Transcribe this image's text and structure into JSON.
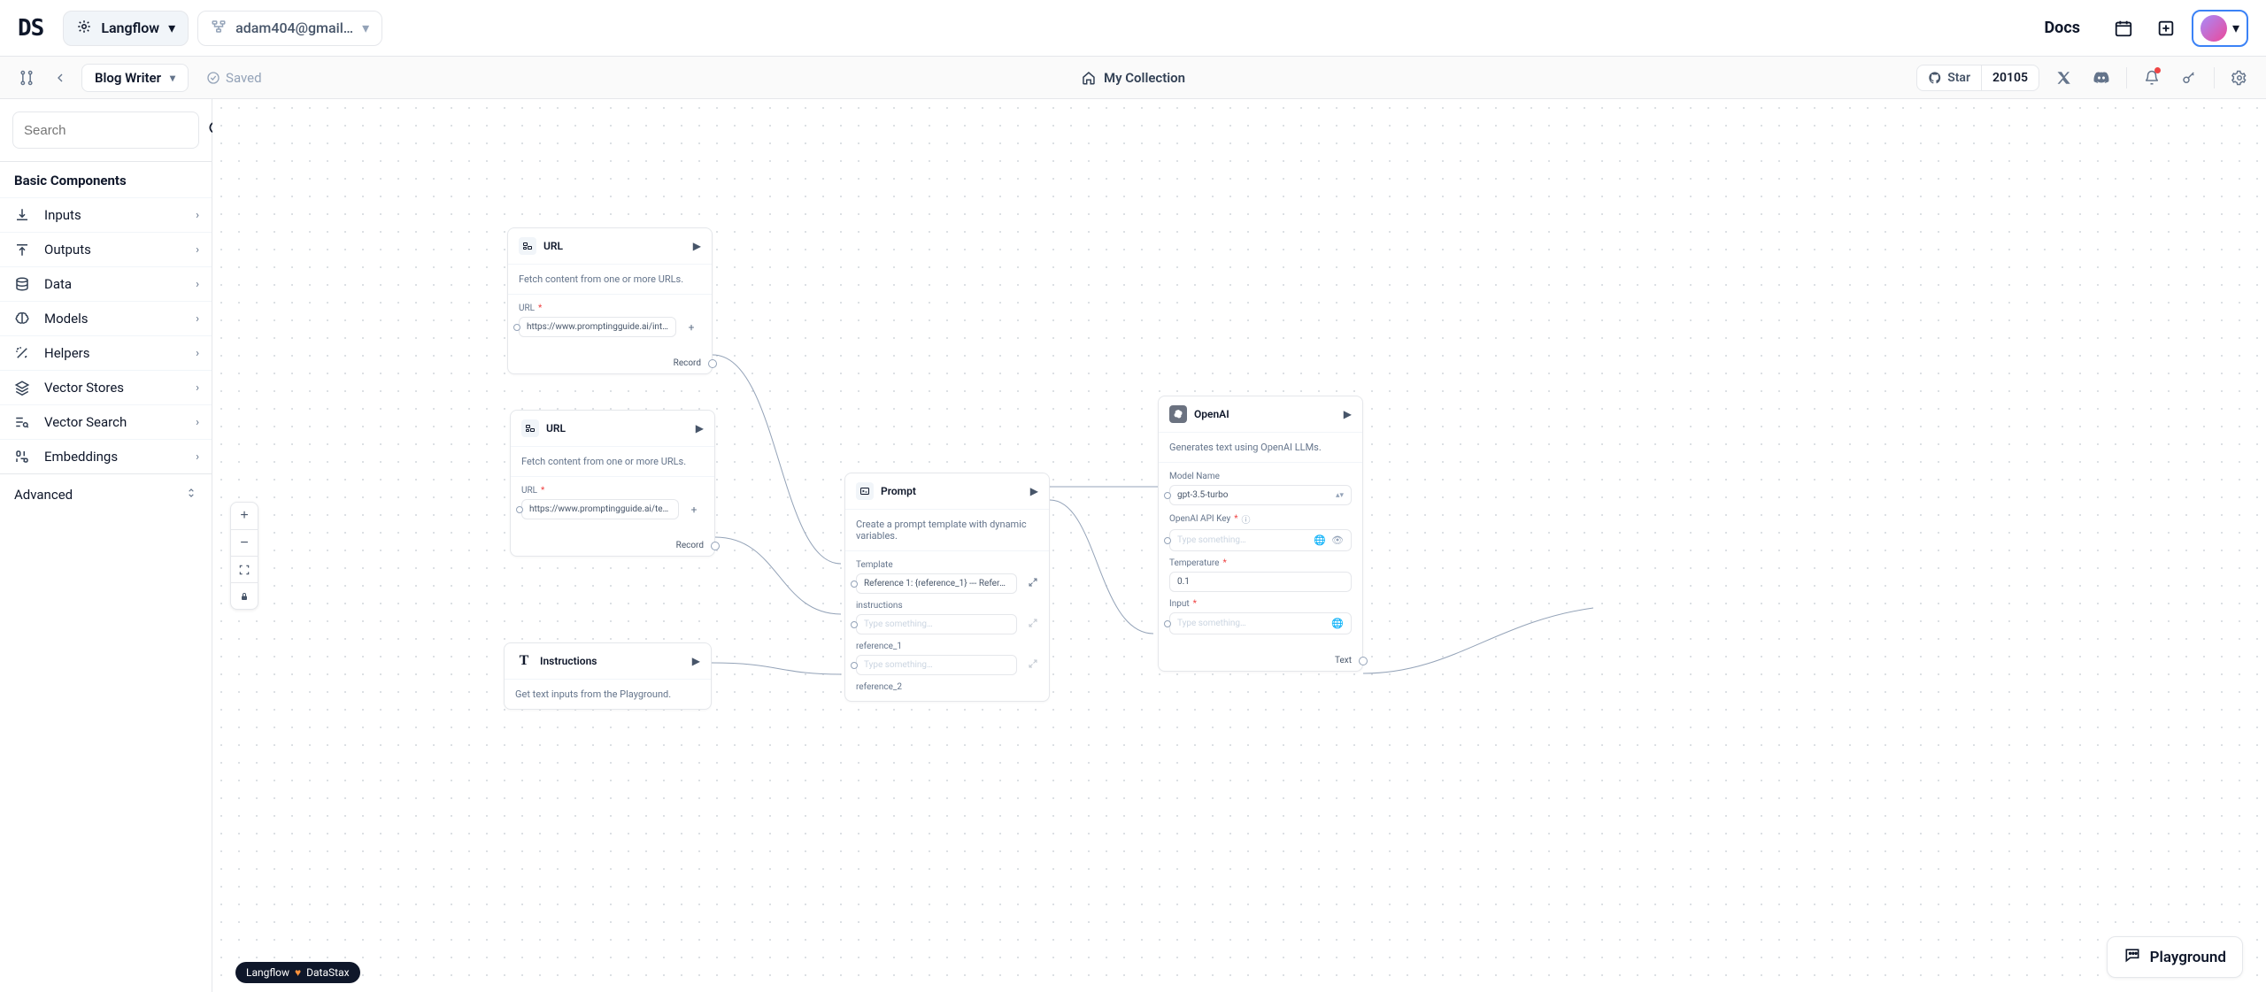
{
  "top": {
    "logo": "DS",
    "workspace": "Langflow",
    "account": "adam404@gmail…",
    "docs": "Docs"
  },
  "sub": {
    "flow_name": "Blog Writer",
    "saved": "Saved",
    "collection": "My Collection",
    "star": "Star",
    "star_count": "20105"
  },
  "sidebar": {
    "search_placeholder": "Search",
    "basic_title": "Basic Components",
    "categories": [
      {
        "label": "Inputs"
      },
      {
        "label": "Outputs"
      },
      {
        "label": "Data"
      },
      {
        "label": "Models"
      },
      {
        "label": "Helpers"
      },
      {
        "label": "Vector Stores"
      },
      {
        "label": "Vector Search"
      },
      {
        "label": "Embeddings"
      }
    ],
    "advanced": "Advanced"
  },
  "nodes": {
    "url1": {
      "title": "URL",
      "desc": "Fetch content from one or more URLs.",
      "field_label": "URL",
      "value": "https://www.promptingguide.ai/introductio…",
      "output": "Record"
    },
    "url2": {
      "title": "URL",
      "desc": "Fetch content from one or more URLs.",
      "field_label": "URL",
      "value": "https://www.promptingguide.ai/techniques…",
      "output": "Record"
    },
    "instr": {
      "title": "Instructions",
      "desc": "Get text inputs from the Playground."
    },
    "prompt": {
      "title": "Prompt",
      "desc": "Create a prompt template with dynamic variables.",
      "template_label": "Template",
      "template_value": "Reference 1: {reference_1} --- Reference …",
      "instructions_label": "instructions",
      "ref1_label": "reference_1",
      "ref2_label": "reference_2",
      "placeholder": "Type something…"
    },
    "openai": {
      "title": "OpenAI",
      "desc": "Generates text using OpenAI LLMs.",
      "model_label": "Model Name",
      "model_value": "gpt-3.5-turbo",
      "api_label": "OpenAI API Key",
      "api_placeholder": "Type something…",
      "temp_label": "Temperature",
      "temp_value": "0.1",
      "input_label": "Input",
      "input_placeholder": "Type something…",
      "output": "Text"
    }
  },
  "footer": {
    "badge_a": "Langflow",
    "badge_b": "DataStax",
    "playground": "Playground"
  }
}
